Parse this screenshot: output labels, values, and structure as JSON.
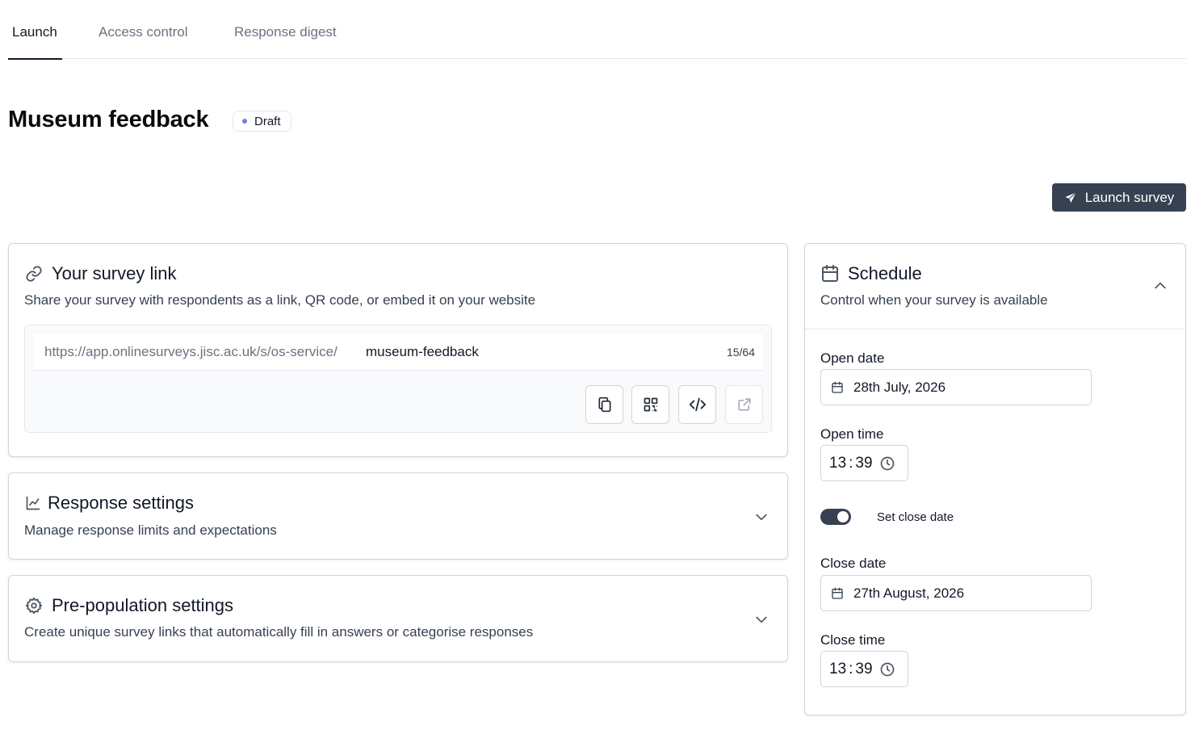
{
  "tabs": [
    {
      "label": "Launch",
      "active": true
    },
    {
      "label": "Access control",
      "active": false
    },
    {
      "label": "Response digest",
      "active": false
    }
  ],
  "page": {
    "title": "Museum feedback",
    "status": "Draft",
    "status_dot_color": "#6d7ce8",
    "launch_label": "Launch survey"
  },
  "survey_link": {
    "title": "Your survey link",
    "description": "Share your survey with respondents as a link, QR code, or embed it on your website",
    "url_prefix": "https://app.onlinesurveys.jisc.ac.uk/s/os-service/",
    "slug": "museum-feedback",
    "char_count": "15/64",
    "actions": [
      "copy-icon",
      "qr-code-icon",
      "code-icon",
      "external-link-icon"
    ]
  },
  "response_settings": {
    "title": "Response settings",
    "description": "Manage response limits and expectations"
  },
  "prepopulation_settings": {
    "title": "Pre-population settings",
    "description": "Create unique survey links that automatically fill in answers or categorise responses"
  },
  "schedule": {
    "title": "Schedule",
    "description": "Control when your survey is available",
    "open_date_label": "Open date",
    "open_date": "28th July, 2026",
    "open_time_label": "Open time",
    "open_time_hours": "13",
    "open_time_minutes": "39",
    "close_toggle_label": "Set close date",
    "close_toggle_on": true,
    "close_date_label": "Close date",
    "close_date": "27th August, 2026",
    "close_time_label": "Close time",
    "close_time_hours": "13",
    "close_time_minutes": "39"
  },
  "colors": {
    "primary": "#374151",
    "border": "#d1d5db",
    "muted_text": "#6b7280"
  }
}
